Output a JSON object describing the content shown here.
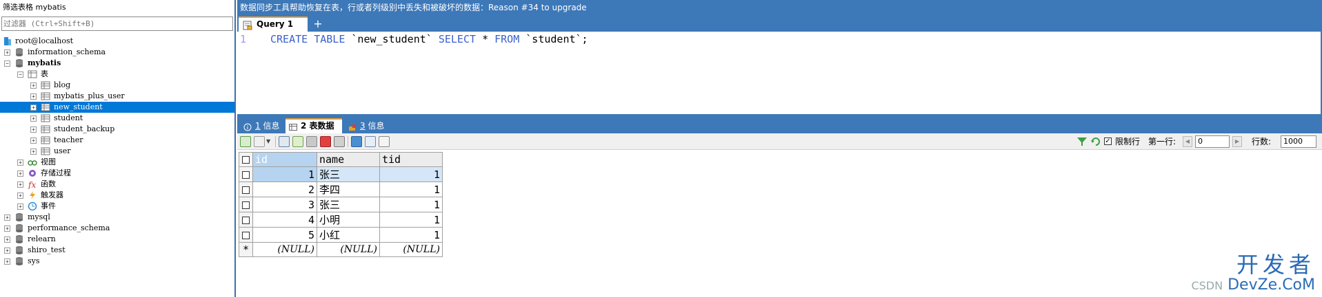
{
  "sidebar": {
    "title": "筛选表格 mybatis",
    "filter_placeholder": "过滤器 (Ctrl+Shift+B)",
    "tree": [
      {
        "label": "root@localhost",
        "level": 0,
        "kind": "connection",
        "expander": "",
        "selected": false,
        "bold": false
      },
      {
        "label": "information_schema",
        "level": 0,
        "kind": "database",
        "expander": "+",
        "selected": false,
        "bold": false
      },
      {
        "label": "mybatis",
        "level": 0,
        "kind": "database",
        "expander": "-",
        "selected": false,
        "bold": true
      },
      {
        "label": "表",
        "level": 1,
        "kind": "tables-folder",
        "expander": "-",
        "selected": false,
        "bold": false
      },
      {
        "label": "blog",
        "level": 2,
        "kind": "table",
        "expander": "+",
        "selected": false,
        "bold": false
      },
      {
        "label": "mybatis_plus_user",
        "level": 2,
        "kind": "table",
        "expander": "+",
        "selected": false,
        "bold": false
      },
      {
        "label": "new_student",
        "level": 2,
        "kind": "table",
        "expander": "+",
        "selected": true,
        "bold": false
      },
      {
        "label": "student",
        "level": 2,
        "kind": "table",
        "expander": "+",
        "selected": false,
        "bold": false
      },
      {
        "label": "student_backup",
        "level": 2,
        "kind": "table",
        "expander": "+",
        "selected": false,
        "bold": false
      },
      {
        "label": "teacher",
        "level": 2,
        "kind": "table",
        "expander": "+",
        "selected": false,
        "bold": false
      },
      {
        "label": "user",
        "level": 2,
        "kind": "table",
        "expander": "+",
        "selected": false,
        "bold": false
      },
      {
        "label": "视图",
        "level": 1,
        "kind": "views-folder",
        "expander": "+",
        "selected": false,
        "bold": false
      },
      {
        "label": "存储过程",
        "level": 1,
        "kind": "procedures-folder",
        "expander": "+",
        "selected": false,
        "bold": false
      },
      {
        "label": "函数",
        "level": 1,
        "kind": "functions-folder",
        "expander": "+",
        "selected": false,
        "bold": false
      },
      {
        "label": "触发器",
        "level": 1,
        "kind": "triggers-folder",
        "expander": "+",
        "selected": false,
        "bold": false
      },
      {
        "label": "事件",
        "level": 1,
        "kind": "events-folder",
        "expander": "+",
        "selected": false,
        "bold": false
      },
      {
        "label": "mysql",
        "level": 0,
        "kind": "database",
        "expander": "+",
        "selected": false,
        "bold": false
      },
      {
        "label": "performance_schema",
        "level": 0,
        "kind": "database",
        "expander": "+",
        "selected": false,
        "bold": false
      },
      {
        "label": "relearn",
        "level": 0,
        "kind": "database",
        "expander": "+",
        "selected": false,
        "bold": false
      },
      {
        "label": "shiro_test",
        "level": 0,
        "kind": "database",
        "expander": "+",
        "selected": false,
        "bold": false
      },
      {
        "label": "sys",
        "level": 0,
        "kind": "database",
        "expander": "+",
        "selected": false,
        "bold": false
      }
    ]
  },
  "hint_bar": "数据同步工具帮助恢复在表，行或者列级别中丢失和被破坏的数据：Reason #34 to upgrade",
  "query_tab": {
    "label": "Query 1",
    "add_label": "+"
  },
  "editor": {
    "line_number": "1",
    "tokens": [
      {
        "text": "CREATE TABLE ",
        "kw": true
      },
      {
        "text": "`new_student` ",
        "kw": false
      },
      {
        "text": "SELECT ",
        "kw": true
      },
      {
        "text": "* ",
        "kw": false
      },
      {
        "text": "FROM ",
        "kw": true
      },
      {
        "text": "`student`;",
        "kw": false
      }
    ]
  },
  "result_tabs": [
    {
      "num": "1",
      "label": "信息",
      "active": false,
      "icon": "info-icon"
    },
    {
      "num": "2",
      "label": "表数据",
      "active": true,
      "icon": "table-data-icon"
    },
    {
      "num": "3",
      "label": "信息",
      "active": false,
      "icon": "lock-info-icon"
    }
  ],
  "grid_controls": {
    "limit_label": "限制行",
    "limit_checked": true,
    "first_row_label": "第一行:",
    "first_row_value": "0",
    "rows_label": "行数:",
    "rows_value": "1000"
  },
  "grid": {
    "columns": [
      "id",
      "name",
      "tid"
    ],
    "rows": [
      {
        "id": "1",
        "name": "张三",
        "tid": "1"
      },
      {
        "id": "2",
        "name": "李四",
        "tid": "1"
      },
      {
        "id": "3",
        "name": "张三",
        "tid": "1"
      },
      {
        "id": "4",
        "name": "小明",
        "tid": "1"
      },
      {
        "id": "5",
        "name": "小红",
        "tid": "1"
      }
    ],
    "new_row_marker": "*",
    "null_text": "(NULL)"
  },
  "watermark": {
    "big": "开发者",
    "small_prefix": "CSDN",
    "small": "DevZe.CoM"
  },
  "colors": {
    "accent": "#3d78b8",
    "selection": "#0078d7",
    "keyword": "#3a5fcd",
    "tab_highlight": "#f0a030"
  }
}
